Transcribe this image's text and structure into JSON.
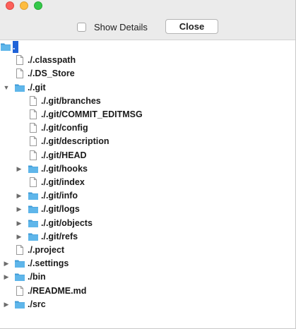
{
  "toolbar": {
    "show_details_label": "Show Details",
    "close_label": "Close"
  },
  "tree": [
    {
      "label": ".",
      "depth": 0,
      "type": "folder",
      "arrow": "none",
      "selected": true
    },
    {
      "label": "./.classpath",
      "depth": 1,
      "type": "file",
      "arrow": "none"
    },
    {
      "label": "./.DS_Store",
      "depth": 1,
      "type": "file",
      "arrow": "none"
    },
    {
      "label": "./.git",
      "depth": 1,
      "type": "folder",
      "arrow": "expanded"
    },
    {
      "label": "./.git/branches",
      "depth": 2,
      "type": "file",
      "arrow": "none"
    },
    {
      "label": "./.git/COMMIT_EDITMSG",
      "depth": 2,
      "type": "file",
      "arrow": "none"
    },
    {
      "label": "./.git/config",
      "depth": 2,
      "type": "file",
      "arrow": "none"
    },
    {
      "label": "./.git/description",
      "depth": 2,
      "type": "file",
      "arrow": "none"
    },
    {
      "label": "./.git/HEAD",
      "depth": 2,
      "type": "file",
      "arrow": "none"
    },
    {
      "label": "./.git/hooks",
      "depth": 2,
      "type": "folder",
      "arrow": "collapsed"
    },
    {
      "label": "./.git/index",
      "depth": 2,
      "type": "file",
      "arrow": "none"
    },
    {
      "label": "./.git/info",
      "depth": 2,
      "type": "folder",
      "arrow": "collapsed"
    },
    {
      "label": "./.git/logs",
      "depth": 2,
      "type": "folder",
      "arrow": "collapsed"
    },
    {
      "label": "./.git/objects",
      "depth": 2,
      "type": "folder",
      "arrow": "collapsed"
    },
    {
      "label": "./.git/refs",
      "depth": 2,
      "type": "folder",
      "arrow": "collapsed"
    },
    {
      "label": "./.project",
      "depth": 1,
      "type": "file",
      "arrow": "none"
    },
    {
      "label": "./.settings",
      "depth": 1,
      "type": "folder",
      "arrow": "collapsed"
    },
    {
      "label": "./bin",
      "depth": 1,
      "type": "folder",
      "arrow": "collapsed"
    },
    {
      "label": "./README.md",
      "depth": 1,
      "type": "file",
      "arrow": "none"
    },
    {
      "label": "./src",
      "depth": 1,
      "type": "folder",
      "arrow": "collapsed"
    }
  ],
  "colors": {
    "folder": "#5fb6ea",
    "folder_dark": "#3e9ad6",
    "selection": "#1f63d8"
  }
}
